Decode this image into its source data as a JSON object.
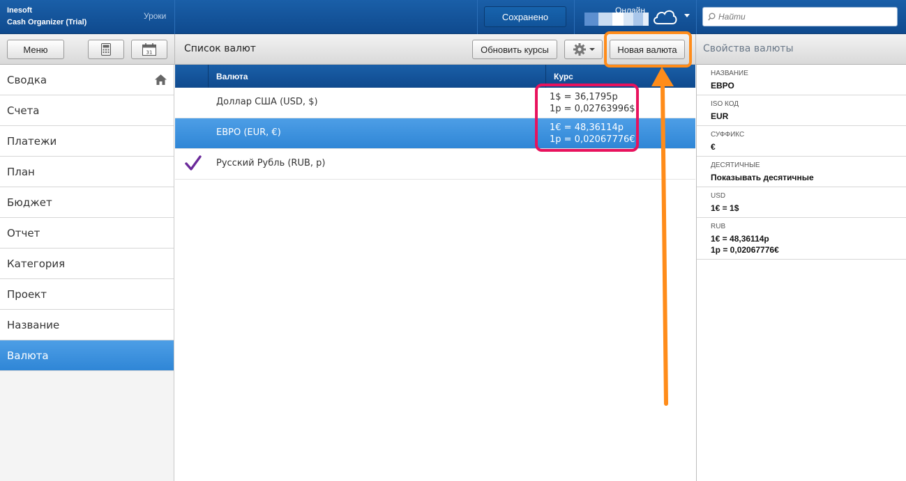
{
  "app": {
    "vendor": "Inesoft",
    "title": "Cash Organizer (Trial)",
    "lessons_link": "Уроки",
    "saved_label": "Сохранено",
    "online_label": "Онлайн",
    "search_placeholder": "Найти"
  },
  "toolbar": {
    "menu_label": "Меню",
    "list_title": "Список валют",
    "update_rates_label": "Обновить курсы",
    "new_currency_label": "Новая валюта",
    "properties_title": "Свойства валюты"
  },
  "sidebar": {
    "items": [
      {
        "label": "Сводка"
      },
      {
        "label": "Счета"
      },
      {
        "label": "Платежи"
      },
      {
        "label": "План"
      },
      {
        "label": "Бюджет"
      },
      {
        "label": "Отчет"
      },
      {
        "label": "Категория"
      },
      {
        "label": "Проект"
      },
      {
        "label": "Название"
      },
      {
        "label": "Валюта",
        "active": true
      }
    ]
  },
  "table": {
    "columns": {
      "currency": "Валюта",
      "rate": "Курс"
    },
    "rows": [
      {
        "name": "Доллар США (USD, $)",
        "rate1": "1$ = 36,1795р",
        "rate2": "1р = 0,02763996$",
        "selected": false,
        "base": false
      },
      {
        "name": "ЕВРО (EUR, €)",
        "rate1": "1€ = 48,36114р",
        "rate2": "1р = 0,02067776€",
        "selected": true,
        "base": false
      },
      {
        "name": "Русский Рубль (RUB, р)",
        "rate1": "",
        "rate2": "",
        "selected": false,
        "base": true
      }
    ]
  },
  "properties": {
    "name_label": "НАЗВАНИЕ",
    "name_value": "ЕВРО",
    "iso_label": "ISO КОД",
    "iso_value": "EUR",
    "suffix_label": "СУФФИКС",
    "suffix_value": "€",
    "decimals_label": "ДЕСЯТИЧНЫЕ",
    "decimals_value": "Показывать десятичные",
    "usd_label": "USD",
    "usd_value": "1€ = 1$",
    "rub_label": "RUB",
    "rub_value1": "1€ = 48,36114р",
    "rub_value2": "1р = 0,02067776€"
  },
  "colors": {
    "header_blue": "#1a5fa8",
    "selection_blue": "#3a8fdc",
    "check_purple": "#6b2a9a",
    "annotation_orange": "#ff8c1a",
    "annotation_pink": "#e8125d"
  }
}
